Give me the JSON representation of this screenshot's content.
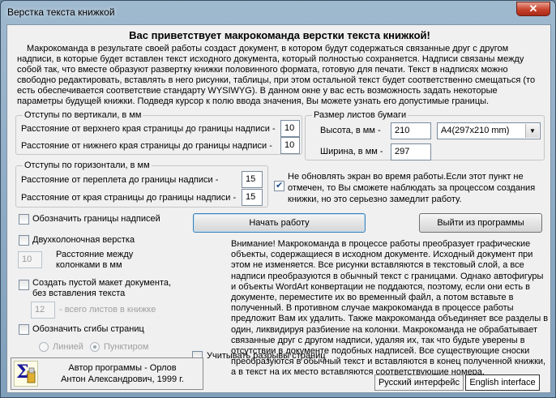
{
  "window": {
    "title": "Верстка текста книжкой",
    "close_label": "✕"
  },
  "heading": "Вас приветствует макрокоманда верстки текста книжкой!",
  "intro": "Макрокоманда в результате своей работы создаст документ, в котором будут содержаться связанные друг с другом надписи, в которые будет вставлен текст исходного документа, который полностью сохраняется. Надписи связаны между собой так, что вместе образуют развертку книжки половинного формата, готовую для печати. Текст в надписях можно свободно редактировать, вставлять в него рисунки, таблицы, при этом остальной текст будет соответственно смещаться (то есть обеспечивается соответствие стандарту WYSIWYG). В данном окне у вас есть возможность задать некоторые параметры будущей книжки. Подведя курсор к полю ввода значения, Вы можете узнать его допустимые границы.",
  "vertical": {
    "legend": "Отступы по вертикали, в мм",
    "top_label": "Расстояние от верхнего края страницы до границы надписи -",
    "top_value": "10",
    "bottom_label": "Расстояние от нижнего края страницы до границы надписи -",
    "bottom_value": "10"
  },
  "paper": {
    "legend": "Размер листов бумаги",
    "height_label": "Высота, в мм -",
    "height_value": "210",
    "width_label": "Ширина, в мм -",
    "width_value": "297",
    "format_value": "А4(297x210 mm)"
  },
  "horizontal": {
    "legend": "Отступы по горизонтали, в мм",
    "binding_label": "Расстояние от переплета до границы надписи -",
    "binding_value": "15",
    "edge_label": "Расстояние от края страницы до границы надписи -",
    "edge_value": "15"
  },
  "no_refresh": {
    "label": "Не обновлять экран во время работы.Если этот пункт не отмечен, то Вы сможете наблюдать за процессом создания книжки, но это серьезно замедлит работу.",
    "checked": true
  },
  "options": {
    "mark_borders": "Обозначить границы надписей",
    "two_columns": "Двухколоночная верстка",
    "column_gap_value": "10",
    "column_gap_label": "Расстояние между колонками в мм",
    "empty_layout": "Создать пустой макет документа, без вставления текста",
    "sheets_value": "12",
    "sheets_label": "- всего листов в книжке",
    "mark_folds": "Обозначить сгибы страниц",
    "line_label": "Линией",
    "dotted_label": "Пунктиром",
    "page_breaks": "Учитывать разрывы страниц"
  },
  "buttons": {
    "start": "Начать работу",
    "exit": "Выйти из программы"
  },
  "warning": "Внимание! Макрокоманда в процессе работы преобразует графические объекты, содержащиеся в исходном документе. Исходный документ при этом не изменяется. Все рисунки вставляются в текстовый слой, а все надписи преобразуются в обычный текст с границами. Однако автофигуры и объекты WordArt конвертации не поддаются, поэтому, если они есть в документе, переместите их во временный файл, а потом вставьте в полученный. В противном случае макрокоманда в процессе работы предложит Вам их удалить. Также макрокоманда объединяет все разделы в один, ликвидируя разбиение на колонки. Макрокоманда не обрабатывает связанные друг с другом надписи, удаляя их, так что будьте уверены в отсутствии в документе подобных надписей. Все существующие сноски преобразуются в обычный текст и вставляются в конец полученной книжки, а в текст на их место вставляются соответствующие номера.",
  "author": {
    "line1": "Автор программы - Орлов",
    "line2": "Антон Александрович, 1999 г."
  },
  "language": {
    "russian": "Русский интерфейс",
    "english": "English interface"
  },
  "colors": {
    "close_red": "#c8422c",
    "focus_blue": "#3c7fb1"
  }
}
